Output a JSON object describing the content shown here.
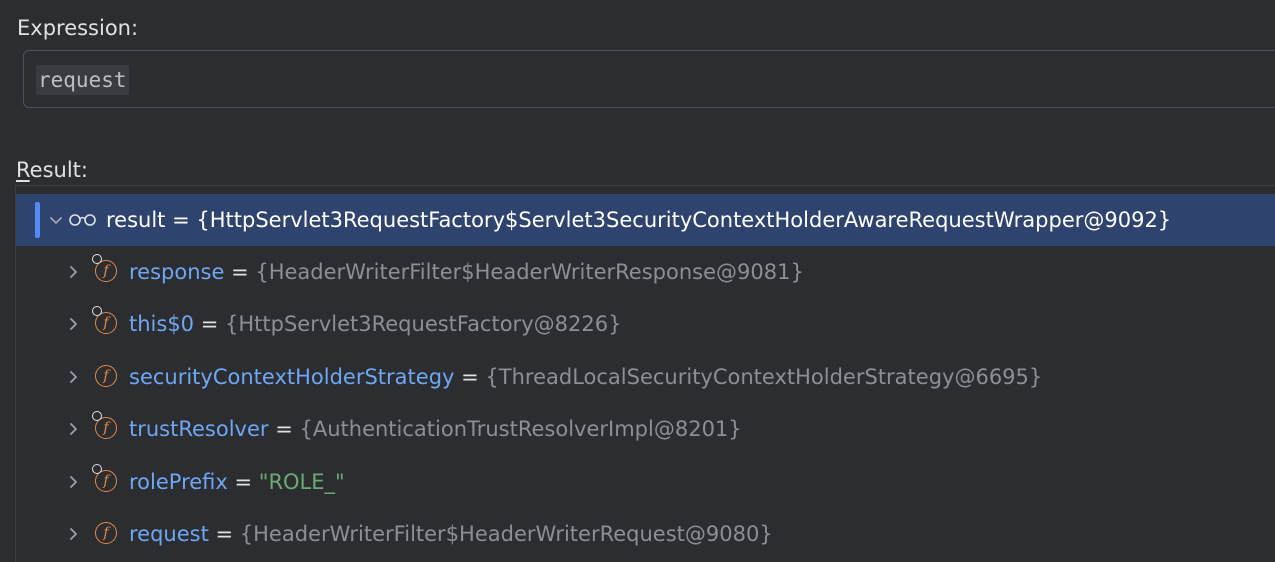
{
  "expression": {
    "label": "Expression:",
    "value": "request"
  },
  "result": {
    "label_mnemonic": "R",
    "label_rest": "esult:",
    "root": {
      "name": "result",
      "eq": " = ",
      "value": "{HttpServlet3RequestFactory$Servlet3SecurityContextHolderAwareRequestWrapper@9092}",
      "icon": "watch-glasses-icon"
    },
    "children": [
      {
        "name": "response",
        "eq": " = ",
        "value": "{HeaderWriterFilter$HeaderWriterResponse@9081}",
        "icon": "field-pinned-icon",
        "value_kind": "object"
      },
      {
        "name": "this$0",
        "eq": " = ",
        "value": "{HttpServlet3RequestFactory@8226}",
        "icon": "field-pinned-icon",
        "value_kind": "object"
      },
      {
        "name": "securityContextHolderStrategy",
        "eq": " = ",
        "value": "{ThreadLocalSecurityContextHolderStrategy@6695}",
        "icon": "field-icon",
        "value_kind": "object"
      },
      {
        "name": "trustResolver",
        "eq": " = ",
        "value": "{AuthenticationTrustResolverImpl@8201}",
        "icon": "field-pinned-icon",
        "value_kind": "object"
      },
      {
        "name": "rolePrefix",
        "eq": " = ",
        "value": "\"ROLE_\"",
        "icon": "field-pinned-icon",
        "value_kind": "string"
      },
      {
        "name": "request",
        "eq": " = ",
        "value": "{HeaderWriterFilter$HeaderWriterRequest@9080}",
        "icon": "field-icon",
        "value_kind": "object"
      }
    ]
  },
  "colors": {
    "background": "#2b2d30",
    "selection": "#2e436e",
    "field_name": "#6fa7f5",
    "value_gray": "#8c8f96",
    "string_green": "#6aab73",
    "field_icon_orange": "#e38a4b"
  }
}
